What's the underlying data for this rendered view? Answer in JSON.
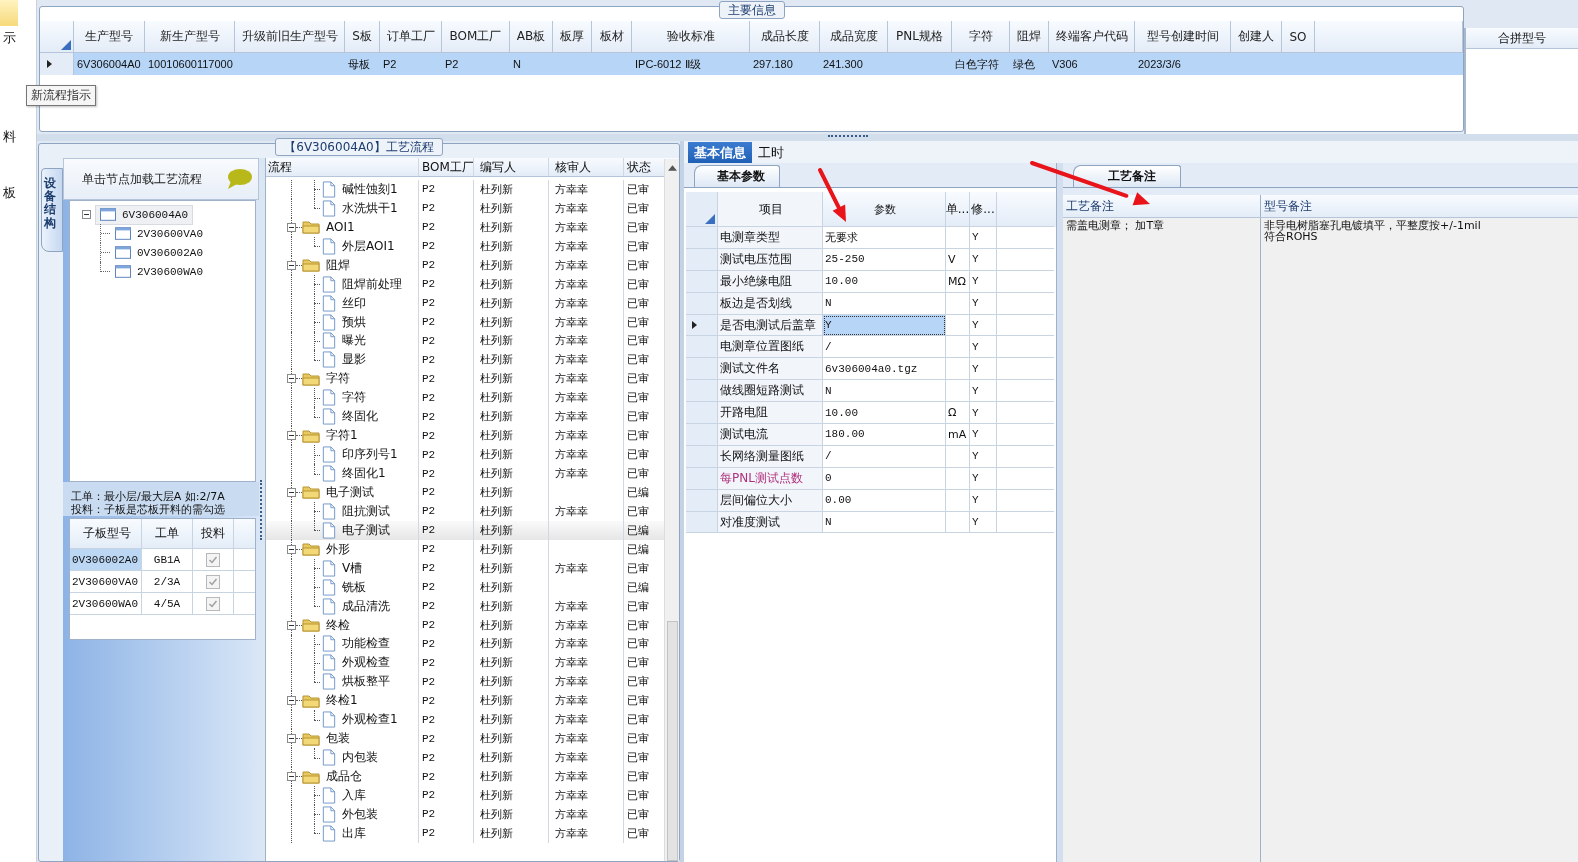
{
  "side_items": [
    {
      "label": "示",
      "selected": true
    },
    {
      "label": "料",
      "selected": false
    },
    {
      "label": "板",
      "selected": false
    }
  ],
  "main_info": {
    "title": "主要信息",
    "columns": [
      "生产型号",
      "新生产型号",
      "升级前旧生产型号",
      "S板",
      "订单工厂",
      "BOM工厂",
      "AB板",
      "板厚",
      "板材",
      "验收标准",
      "成品长度",
      "成品宽度",
      "PNL规格",
      "字符",
      "阻焊",
      "终端客户代码",
      "型号创建时间",
      "创建人",
      "SO"
    ],
    "rows": [
      {
        "selected": true,
        "cells": [
          "6V306004A0",
          "10010600117000",
          null,
          "母板",
          "P2",
          "P2",
          "N",
          null,
          null,
          "IPC-6012 Ⅱ级",
          "297.180",
          "241.300",
          null,
          "白色字符",
          "绿色",
          "V306",
          "2023/3/6",
          null,
          null
        ]
      }
    ],
    "tooltip": "新流程指示"
  },
  "merge": {
    "title": "合拼型号"
  },
  "process": {
    "title": "【6V306004A0】工艺流程",
    "side_tab": {
      "label": "设备结构",
      "selected": true
    },
    "tree_hint": "单击节点加载工艺流程",
    "tree": {
      "label": "6V306004A0",
      "selected": true,
      "expanded": true,
      "children": [
        {
          "label": "2V30600VA0",
          "selected": false
        },
        {
          "label": "0V306002A0",
          "selected": false
        },
        {
          "label": "2V30600WA0",
          "selected": false
        }
      ]
    },
    "notes": [
      "工单：最小层/最大层A 如:2/7A",
      "投料：子板是芯板开料的需勾选"
    ],
    "boards": {
      "columns": [
        "子板型号",
        "工单",
        "投料"
      ],
      "rows": [
        {
          "model": "0V306002A0",
          "order": "GB1A",
          "checked": true,
          "selected": true
        },
        {
          "model": "2V30600VA0",
          "order": "2/3A",
          "checked": true,
          "selected": false
        },
        {
          "model": "2V30600WA0",
          "order": "4/5A",
          "checked": true,
          "selected": false
        }
      ]
    }
  },
  "flow": {
    "columns": [
      "流程",
      "BOM工厂",
      "编写人",
      "核审人",
      "状态"
    ],
    "steps": [
      {
        "children": [
          {
            "name": "碱性蚀刻1",
            "bom": "P2",
            "writer": "杜列新",
            "reviewer": "方幸幸",
            "status": "已审",
            "selected": false
          },
          {
            "name": "水洗烘干1",
            "bom": "P2",
            "writer": "杜列新",
            "reviewer": "方幸幸",
            "status": "已审",
            "selected": false
          }
        ]
      },
      {
        "name": "AOI1",
        "bom": "P2",
        "writer": "杜列新",
        "reviewer": "方幸幸",
        "status": "已审",
        "selected": false,
        "expanded": true,
        "children": [
          {
            "name": "外层AOI1",
            "bom": "P2",
            "writer": "杜列新",
            "reviewer": "方幸幸",
            "status": "已审",
            "selected": false
          }
        ]
      },
      {
        "name": "阻焊",
        "bom": "P2",
        "writer": "杜列新",
        "reviewer": "方幸幸",
        "status": "已审",
        "selected": false,
        "expanded": true,
        "children": [
          {
            "name": "阻焊前处理",
            "bom": "P2",
            "writer": "杜列新",
            "reviewer": "方幸幸",
            "status": "已审",
            "selected": false
          },
          {
            "name": "丝印",
            "bom": "P2",
            "writer": "杜列新",
            "reviewer": "方幸幸",
            "status": "已审",
            "selected": false
          },
          {
            "name": "预烘",
            "bom": "P2",
            "writer": "杜列新",
            "reviewer": "方幸幸",
            "status": "已审",
            "selected": false
          },
          {
            "name": "曝光",
            "bom": "P2",
            "writer": "杜列新",
            "reviewer": "方幸幸",
            "status": "已审",
            "selected": false
          },
          {
            "name": "显影",
            "bom": "P2",
            "writer": "杜列新",
            "reviewer": "方幸幸",
            "status": "已审",
            "selected": false
          }
        ]
      },
      {
        "name": "字符",
        "bom": "P2",
        "writer": "杜列新",
        "reviewer": "方幸幸",
        "status": "已审",
        "selected": false,
        "expanded": true,
        "children": [
          {
            "name": "字符",
            "bom": "P2",
            "writer": "杜列新",
            "reviewer": "方幸幸",
            "status": "已审",
            "selected": false
          },
          {
            "name": "终固化",
            "bom": "P2",
            "writer": "杜列新",
            "reviewer": "方幸幸",
            "status": "已审",
            "selected": false
          }
        ]
      },
      {
        "name": "字符1",
        "bom": "P2",
        "writer": "杜列新",
        "reviewer": "方幸幸",
        "status": "已审",
        "selected": false,
        "expanded": true,
        "children": [
          {
            "name": "印序列号1",
            "bom": "P2",
            "writer": "杜列新",
            "reviewer": "方幸幸",
            "status": "已审",
            "selected": false
          },
          {
            "name": "终固化1",
            "bom": "P2",
            "writer": "杜列新",
            "reviewer": "方幸幸",
            "status": "已审",
            "selected": false
          }
        ]
      },
      {
        "name": "电子测试",
        "bom": "P2",
        "writer": "杜列新",
        "status": "已编",
        "selected": false,
        "expanded": true,
        "children": [
          {
            "name": "阻抗测试",
            "bom": "P2",
            "writer": "杜列新",
            "reviewer": "方幸幸",
            "status": "已审",
            "selected": false
          },
          {
            "name": "电子测试",
            "bom": "P2",
            "writer": "杜列新",
            "status": "已编",
            "selected": true
          }
        ]
      },
      {
        "name": "外形",
        "bom": "P2",
        "writer": "杜列新",
        "status": "已编",
        "selected": false,
        "expanded": true,
        "children": [
          {
            "name": "V槽",
            "bom": "P2",
            "writer": "杜列新",
            "reviewer": "方幸幸",
            "status": "已审",
            "selected": false
          },
          {
            "name": "铣板",
            "bom": "P2",
            "writer": "杜列新",
            "status": "已编",
            "selected": false
          },
          {
            "name": "成品清洗",
            "bom": "P2",
            "writer": "杜列新",
            "reviewer": "方幸幸",
            "status": "已审",
            "selected": false
          }
        ]
      },
      {
        "name": "终检",
        "bom": "P2",
        "writer": "杜列新",
        "reviewer": "方幸幸",
        "status": "已审",
        "selected": false,
        "expanded": true,
        "children": [
          {
            "name": "功能检查",
            "bom": "P2",
            "writer": "杜列新",
            "reviewer": "方幸幸",
            "status": "已审",
            "selected": false
          },
          {
            "name": "外观检查",
            "bom": "P2",
            "writer": "杜列新",
            "reviewer": "方幸幸",
            "status": "已审",
            "selected": false
          },
          {
            "name": "烘板整平",
            "bom": "P2",
            "writer": "杜列新",
            "reviewer": "方幸幸",
            "status": "已审",
            "selected": false
          }
        ]
      },
      {
        "name": "终检1",
        "bom": "P2",
        "writer": "杜列新",
        "reviewer": "方幸幸",
        "status": "已审",
        "selected": false,
        "expanded": true,
        "children": [
          {
            "name": "外观检查1",
            "bom": "P2",
            "writer": "杜列新",
            "reviewer": "方幸幸",
            "status": "已审",
            "selected": false
          }
        ]
      },
      {
        "name": "包装",
        "bom": "P2",
        "writer": "杜列新",
        "reviewer": "方幸幸",
        "status": "已审",
        "selected": false,
        "expanded": true,
        "children": [
          {
            "name": "内包装",
            "bom": "P2",
            "writer": "杜列新",
            "reviewer": "方幸幸",
            "status": "已审",
            "selected": false
          }
        ]
      },
      {
        "name": "成品仓",
        "bom": "P2",
        "writer": "杜列新",
        "reviewer": "方幸幸",
        "status": "已审",
        "selected": false,
        "expanded": true,
        "children": [
          {
            "name": "入库",
            "bom": "P2",
            "writer": "杜列新",
            "reviewer": "方幸幸",
            "status": "已审",
            "selected": false
          },
          {
            "name": "外包装",
            "bom": "P2",
            "writer": "杜列新",
            "reviewer": "方幸幸",
            "status": "已审",
            "selected": false
          },
          {
            "name": "出库",
            "bom": "P2",
            "writer": "杜列新",
            "reviewer": "方幸幸",
            "status": "已审",
            "selected": false
          }
        ]
      }
    ]
  },
  "detail": {
    "tabs": [
      {
        "label": "基本信息",
        "selected": true
      },
      {
        "label": "工时",
        "selected": false
      }
    ],
    "params": {
      "tab": {
        "label": "基本参数",
        "selected": true
      },
      "columns": [
        "项目",
        "参数",
        "单...",
        "修..."
      ],
      "rows": [
        {
          "item": "电测章类型",
          "value": "无要求",
          "flag": "Y",
          "selected": false,
          "highlighted": false
        },
        {
          "item": "测试电压范围",
          "value": "25-250",
          "unit": "V",
          "flag": "Y",
          "selected": false,
          "highlighted": false
        },
        {
          "item": "最小绝缘电阻",
          "value": "10.00",
          "unit": "MΩ",
          "flag": "Y",
          "selected": false,
          "highlighted": false
        },
        {
          "item": "板边是否划线",
          "value": "N",
          "flag": "Y",
          "selected": false,
          "highlighted": false
        },
        {
          "item": "是否电测试后盖章",
          "value": "Y",
          "flag": "Y",
          "selected": true,
          "highlighted": false
        },
        {
          "item": "电测章位置图纸",
          "value": "/",
          "flag": "Y",
          "selected": false,
          "highlighted": false
        },
        {
          "item": "测试文件名",
          "value": "6v306004a0.tgz",
          "flag": "Y",
          "selected": false,
          "highlighted": false
        },
        {
          "item": "做线圈短路测试",
          "value": "N",
          "flag": "Y",
          "selected": false,
          "highlighted": false
        },
        {
          "item": "开路电阻",
          "value": "10.00",
          "unit": "Ω",
          "flag": "Y",
          "selected": false,
          "highlighted": false
        },
        {
          "item": "测试电流",
          "value": "180.00",
          "unit": "mA",
          "flag": "Y",
          "selected": false,
          "highlighted": false
        },
        {
          "item": "长网络测量图纸",
          "value": "/",
          "flag": "Y",
          "selected": false,
          "highlighted": false
        },
        {
          "item": "每PNL测试点数",
          "value": "0",
          "flag": "Y",
          "selected": false,
          "highlighted": true
        },
        {
          "item": "层间偏位大小",
          "value": "0.00",
          "flag": "Y",
          "selected": false,
          "highlighted": false
        },
        {
          "item": "对准度测试",
          "value": "N",
          "flag": "Y",
          "selected": false,
          "highlighted": false
        }
      ]
    },
    "remarks": {
      "tab": {
        "label": "工艺备注",
        "selected": true
      },
      "columns": [
        "工艺备注",
        "型号备注"
      ],
      "process_note": "需盖电测章； 加T章",
      "model_note": [
        "非导电树脂塞孔电镀填平，平整度按+/-1mil",
        "符合ROHS"
      ]
    }
  },
  "annotations": [
    {
      "kind": "arrow"
    },
    {
      "kind": "arrow"
    }
  ]
}
